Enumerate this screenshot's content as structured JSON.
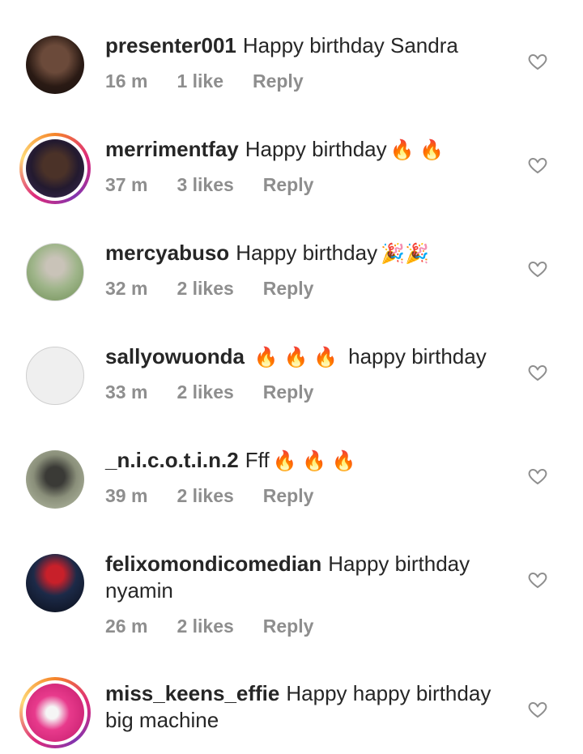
{
  "comments": [
    {
      "username": "presenter001",
      "text": "Happy birthday Sandra",
      "emojis": "",
      "time": "16 m",
      "likes": "1 like",
      "reply": "Reply"
    },
    {
      "username": "merrimentfay",
      "text": "Happy birthday",
      "emojis": "🔥 🔥",
      "time": "37 m",
      "likes": "3 likes",
      "reply": "Reply"
    },
    {
      "username": "mercyabuso",
      "text": "Happy birthday",
      "emojis": "🎉🎉",
      "time": "32 m",
      "likes": "2 likes",
      "reply": "Reply"
    },
    {
      "username": "sallyowuonda",
      "text": "happy birthday",
      "emojis": "🔥 🔥 🔥",
      "time": "33 m",
      "likes": "2 likes",
      "reply": "Reply"
    },
    {
      "username": "_n.i.c.o.t.i.n.2",
      "text": "Fff",
      "emojis": "🔥 🔥 🔥",
      "time": "39 m",
      "likes": "2 likes",
      "reply": "Reply"
    },
    {
      "username": "felixomondicomedian",
      "text": "Happy birthday nyamin",
      "emojis": "",
      "time": "26 m",
      "likes": "2 likes",
      "reply": "Reply"
    },
    {
      "username": "miss_keens_effie",
      "text": "Happy happy birthday big machine",
      "emojis": "",
      "time": "",
      "likes": "",
      "reply": ""
    }
  ],
  "icons": {
    "heart": "heart-outline-icon",
    "avatar": "user-avatar"
  },
  "colors": {
    "username": "#262626",
    "meta": "#8e8e8e",
    "story_ring_start": "#f58529",
    "story_ring_end": "#dd2a7b"
  }
}
